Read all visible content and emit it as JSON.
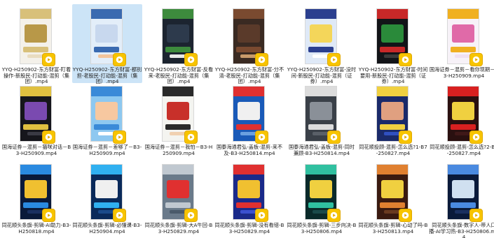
{
  "files": [
    {
      "name": "YYQ-H250902-东方财富-盯着操作-新股民-打动能-混剪（集团）.mp4",
      "selected": false,
      "colors": [
        "#f4f1ea",
        "#d8c07a",
        "#b89848",
        "#e9dcc0"
      ]
    },
    {
      "name": "YYQ-H250902-东方财富-都别担-老股民-打动能-混剪（集团）.mp4",
      "selected": true,
      "colors": [
        "#e3eef9",
        "#3a6ab0",
        "#c8d8ee",
        "#f2c49b"
      ]
    },
    {
      "name": "YYQ-H250902-东方财富-反看来-老股民-打动能-混剪（集团）.mp4",
      "selected": false,
      "colors": [
        "#1c2430",
        "#3d8b3d",
        "#2d3a4c",
        "#e9e9e9"
      ]
    },
    {
      "name": "YYQ-H250902-东方财富-分不清-老股民-打动能-混剪（集团）.mp4",
      "selected": false,
      "colors": [
        "#3a2a22",
        "#7a4a30",
        "#5a3a2a",
        "#c89a6a"
      ]
    },
    {
      "name": "YYQ-H250902-东方财富-没时间-新股民-打动能-混剪（证券）.mp4",
      "selected": false,
      "colors": [
        "#dfe9f7",
        "#2b3f8f",
        "#f4d65a",
        "#ffffff"
      ]
    },
    {
      "name": "YYQ-H250902-东方财富-时间要用-新股民-打动能-混剪（证券）.mp4",
      "selected": false,
      "colors": [
        "#121418",
        "#c82828",
        "#2a8a3a",
        "#3a3a3a"
      ]
    },
    {
      "name": "国海证券－混剪－看你现期－B3-H250909.mp4",
      "selected": false,
      "colors": [
        "#f7f2f8",
        "#f0b020",
        "#e06aa8",
        "#f0e0f0"
      ]
    },
    {
      "name": "国海证券－混剪－猫咪对话－B3-H250909.mp4",
      "selected": false,
      "colors": [
        "#16161c",
        "#e0c040",
        "#7a4ab0",
        "#3a3a44"
      ]
    },
    {
      "name": "国海证券－混剪－差够了－B3-H250909.mp4",
      "selected": false,
      "colors": [
        "#8ec8f0",
        "#3a8ad8",
        "#f7c8a0",
        "#ffffff"
      ]
    },
    {
      "name": "国海证券－混剪－我怕－B3-H250909.mp4",
      "selected": false,
      "colors": [
        "#f4f4f0",
        "#2a2a2a",
        "#c8302a",
        "#f0d0b0"
      ]
    },
    {
      "name": "国泰海通君弘-盖板-混剪-来不及-B3-H250814.mp4",
      "selected": false,
      "colors": [
        "#1a5ab8",
        "#e03030",
        "#f0f0f0",
        "#6aa0e0"
      ]
    },
    {
      "name": "国泰海通君弘-盖板-混剪-同时兼顾-B3-H250814.mp4",
      "selected": false,
      "colors": [
        "#3a4048",
        "#dcdcdc",
        "#8a9098",
        "#5a6068"
      ]
    },
    {
      "name": "同花顺投顾-混剪-怎么选?1-B7-250827.mp4",
      "selected": false,
      "colors": [
        "#1a2a6a",
        "#f0d040",
        "#e0a080",
        "#3050c0"
      ]
    },
    {
      "name": "同花顺投顾-混剪-怎么选?2-B7-250827.mp4",
      "selected": false,
      "colors": [
        "#2a1010",
        "#d82020",
        "#f0d040",
        "#401818"
      ]
    },
    {
      "name": "同花顺头条旗-剪辑-AI助力-B3-H250818.mp4",
      "selected": false,
      "colors": [
        "#0a1a3a",
        "#2a8ae0",
        "#f0c030",
        "#1a3060"
      ]
    },
    {
      "name": "同花顺头条旗-剪辑-必懂课-B3-H250904.mp4",
      "selected": false,
      "colors": [
        "#0a2a5a",
        "#30b0f0",
        "#f0f0f0",
        "#1a4a8a"
      ]
    },
    {
      "name": "同花顺头条旗-剪辑-大A牛回-B3-H250829.mp4",
      "selected": false,
      "colors": [
        "#6a7a8a",
        "#c0c8d0",
        "#e03030",
        "#4a5a6a"
      ]
    },
    {
      "name": "同花顺头条旗-剪辑-没有看错-B3-H250829.mp4",
      "selected": false,
      "colors": [
        "#1a2a8a",
        "#e03030",
        "#f0c030",
        "#3a50d0"
      ]
    },
    {
      "name": "同花顺头条旗-剪辑-三步向决-B3-H250806.mp4",
      "selected": false,
      "colors": [
        "#0a2a2a",
        "#30c0a0",
        "#f0d040",
        "#1a4a4a"
      ]
    },
    {
      "name": "同花顺头条旗-剪辑-心动了吗-B3-H250813.mp4",
      "selected": false,
      "colors": [
        "#3a1a10",
        "#e08030",
        "#f0d040",
        "#6a3a20"
      ]
    },
    {
      "name": "同花顺头条旗-数字人-带人口播-AI学习热-B3-H250806.mp4",
      "selected": false,
      "colors": [
        "#0a1a3a",
        "#4a8ae0",
        "#d0e0f0",
        "#1a3060"
      ]
    }
  ]
}
